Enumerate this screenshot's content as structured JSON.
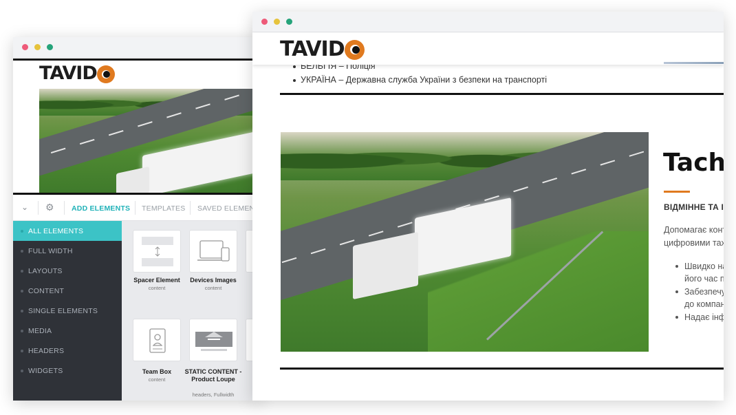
{
  "brand": {
    "logo_left": "TA",
    "logo_right": "VID",
    "accent": "#e07a1f",
    "teal": "#3cc3c6"
  },
  "back_window": {
    "toolbar": {
      "collapse_icon": "chevron-down-icon",
      "settings_icon": "gear-icon",
      "tabs": [
        "ADD ELEMENTS",
        "TEMPLATES",
        "SAVED ELEMENTS"
      ]
    },
    "sidebar": {
      "items": [
        {
          "label": "ALL ELEMENTS",
          "active": true
        },
        {
          "label": "FULL WIDTH"
        },
        {
          "label": "LAYOUTS"
        },
        {
          "label": "CONTENT"
        },
        {
          "label": "SINGLE ELEMENTS"
        },
        {
          "label": "MEDIA"
        },
        {
          "label": "HEADERS"
        },
        {
          "label": "WIDGETS"
        }
      ]
    },
    "cards": [
      {
        "title": "Spacer Element",
        "sub": "content",
        "icon": "spacer-icon"
      },
      {
        "title": "Devices Images",
        "sub": "content",
        "icon": "devices-icon"
      },
      {
        "title": "Team Box",
        "sub": "content",
        "icon": "team-box-icon"
      },
      {
        "title": "STATIC CONTENT - Product Loupe",
        "sub": "headers, Fullwidth",
        "icon": "product-loupe-icon"
      }
    ]
  },
  "front_window": {
    "bullets": [
      "БЕЛЬГІЯ – Поліція",
      "УКРАЇНА – Державна служба України з безпеки на транспорті"
    ],
    "feature": {
      "title": "Tacho",
      "subtitle": "ВІДМІННЕ ТА ІН",
      "paragraph_lines": [
        "Допомагає контр",
        "цифровими тахо"
      ],
      "list": [
        {
          "lines": [
            "Швидко над",
            "його час пра"
          ]
        },
        {
          "lines": [
            "Забезпечує",
            "до компанії"
          ]
        },
        {
          "lines": [
            "Надає інфор"
          ]
        }
      ]
    }
  }
}
